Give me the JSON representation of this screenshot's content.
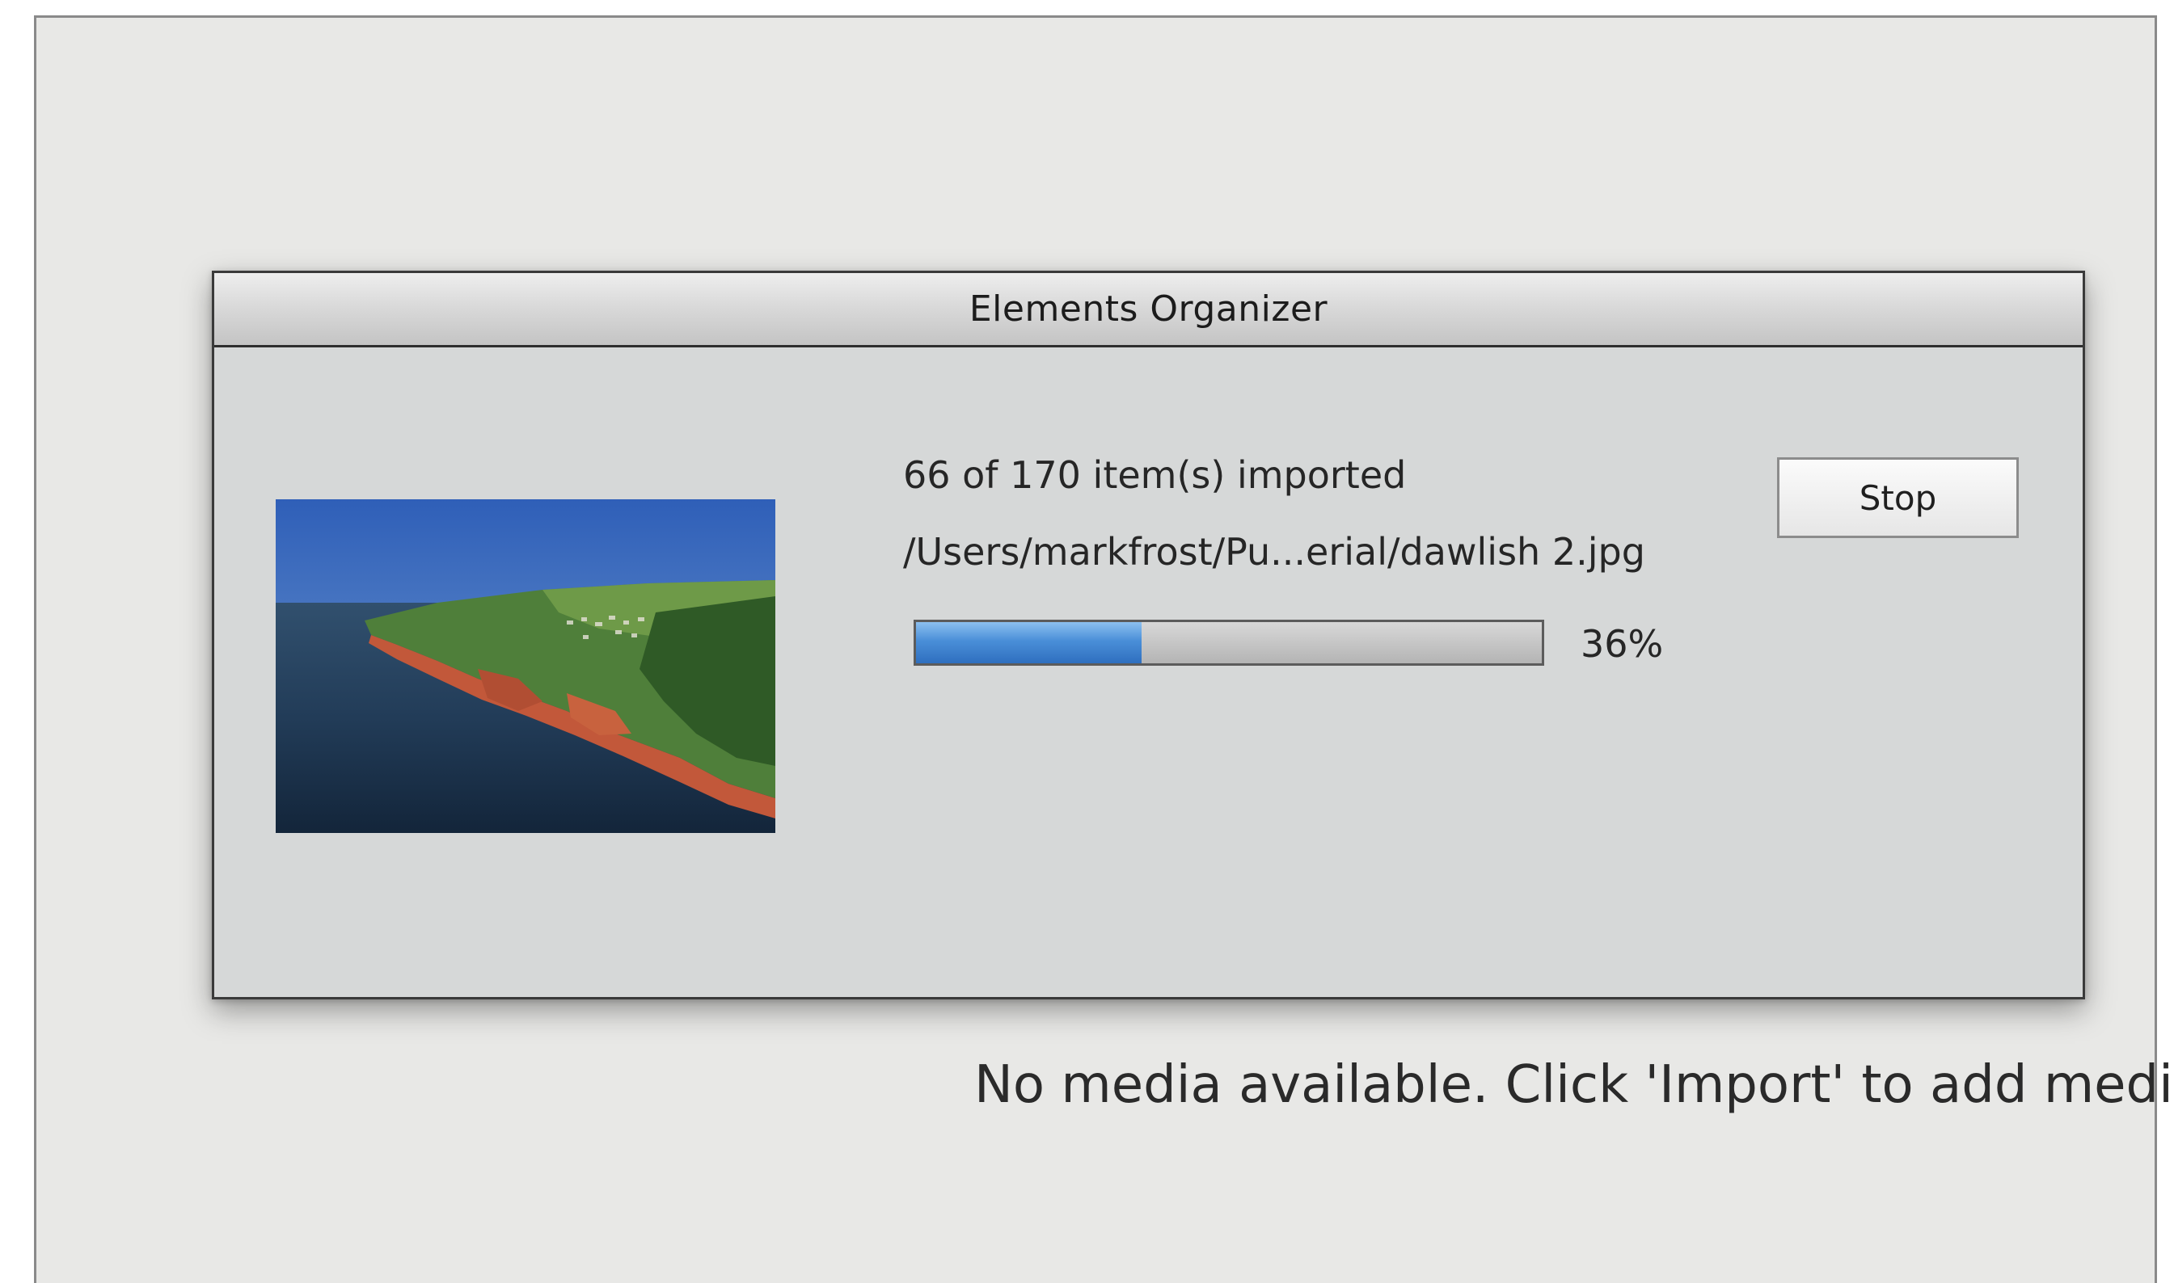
{
  "dialog": {
    "title": "Elements Organizer",
    "status_count": "66 of 170 item(s) imported",
    "current_file": "/Users/markfrost/Pu...erial/dawlish 2.jpg",
    "progress_fraction": 0.36,
    "progress_label": "36%",
    "stop_label": "Stop",
    "thumbnail_icon": "photo-thumbnail"
  },
  "main": {
    "empty_message": "No media available. Click 'Import' to add media"
  },
  "colors": {
    "progress_fill": "#4a8fd8",
    "dialog_background": "#d6d8d8",
    "app_background": "#e8e8e6"
  }
}
